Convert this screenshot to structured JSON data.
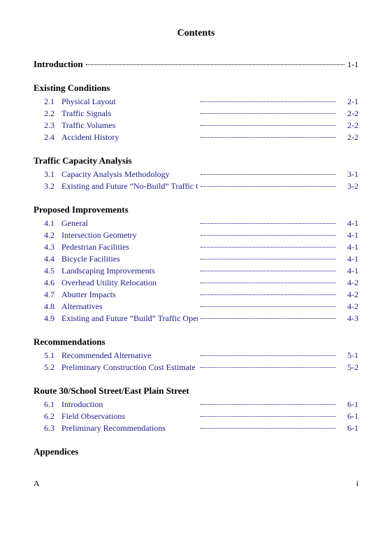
{
  "title": "Contents",
  "intro": {
    "label": "Introduction",
    "page": "1-1"
  },
  "sections": [
    {
      "heading": "Existing Conditions",
      "entries": [
        {
          "num": "2.1",
          "label": "Physical Layout",
          "page": "2-1"
        },
        {
          "num": "2.2",
          "label": "Traffic Signals",
          "page": "2-2"
        },
        {
          "num": "2.3",
          "label": "Traffic Volumes",
          "page": "2-2"
        },
        {
          "num": "2.4",
          "label": "Accident History",
          "page": "2-2"
        }
      ]
    },
    {
      "heading": "Traffic Capacity Analysis",
      "entries": [
        {
          "num": "3.1",
          "label": "Capacity Analysis Methodology",
          "page": "3-1"
        },
        {
          "num": "3.2",
          "label": "Existing and Future “No-Build” Traffic Operations",
          "page": "3-2"
        }
      ]
    },
    {
      "heading": "Proposed Improvements",
      "entries": [
        {
          "num": "4.1",
          "label": "General",
          "page": "4-1"
        },
        {
          "num": "4.2",
          "label": "Intersection Geometry",
          "page": "4-1"
        },
        {
          "num": "4.3",
          "label": "Pedestrian Facilities",
          "page": "4-1"
        },
        {
          "num": "4.4",
          "label": "Bicycle Facilities",
          "page": "4-1"
        },
        {
          "num": "4.5",
          "label": "Landscaping Improvements",
          "page": "4-1"
        },
        {
          "num": "4.6",
          "label": "Overhead Utility Relocation",
          "page": "4-2"
        },
        {
          "num": "4.7",
          "label": "Abutter Impacts",
          "page": "4-2"
        },
        {
          "num": "4.8",
          "label": "Alternatives",
          "page": "4-2"
        },
        {
          "num": "4.9",
          "label": "Existing and Future “Build” Traffic Operations",
          "page": "4-3"
        }
      ]
    },
    {
      "heading": "Recommendations",
      "entries": [
        {
          "num": "5.1",
          "label": "Recommended Alternative",
          "page": "5-1"
        },
        {
          "num": "5.2",
          "label": "Preliminary Construction Cost Estimate",
          "page": "5-2"
        }
      ]
    },
    {
      "heading": "Route 30/School Street/East Plain Street",
      "entries": [
        {
          "num": "6.1",
          "label": "Introduction",
          "page": "6-1"
        },
        {
          "num": "6.2",
          "label": "Field Observations",
          "page": "6-1"
        },
        {
          "num": "6.3",
          "label": "Preliminary Recommendations",
          "page": "6-1"
        }
      ]
    },
    {
      "heading": "Appendices",
      "entries": []
    }
  ],
  "footer": {
    "left": "A",
    "right": "i"
  }
}
